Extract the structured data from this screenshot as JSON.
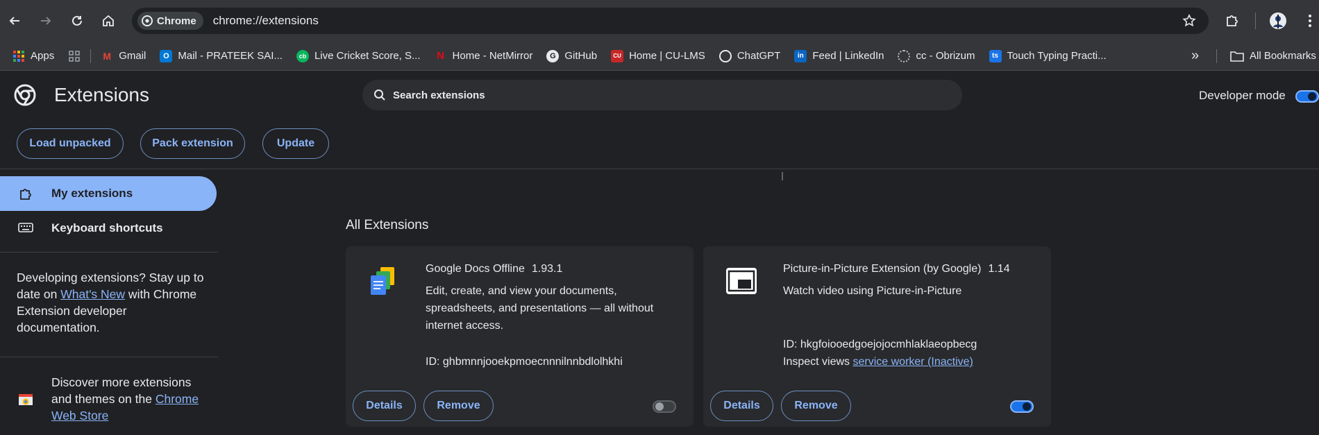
{
  "browser": {
    "chip_label": "Chrome",
    "url": "chrome://extensions"
  },
  "bookmarks": [
    {
      "label": "Apps",
      "icon": "apps-grid-icon",
      "color": "#ea4335"
    },
    {
      "label": "",
      "icon": "tab-groups-icon",
      "color": "#9aa0a6"
    },
    {
      "label": "Gmail",
      "icon": "gmail-icon",
      "color": "#ea4335"
    },
    {
      "label": "Mail - PRATEEK SAI...",
      "icon": "outlook-icon",
      "color": "#0078d4"
    },
    {
      "label": "Live Cricket Score, S...",
      "icon": "cricbuzz-icon",
      "color": "#09b65d"
    },
    {
      "label": "Home - NetMirror",
      "icon": "netmirror-icon",
      "color": "#e50914"
    },
    {
      "label": "GitHub",
      "icon": "github-icon",
      "color": "#ffffff"
    },
    {
      "label": "Home | CU-LMS",
      "icon": "cu-lms-icon",
      "color": "#c62828"
    },
    {
      "label": "ChatGPT",
      "icon": "chatgpt-icon",
      "color": "#ffffff"
    },
    {
      "label": "Feed | LinkedIn",
      "icon": "linkedin-icon",
      "color": "#0a66c2"
    },
    {
      "label": "cc - Obrizum",
      "icon": "obrizum-icon",
      "color": "#9aa0a6"
    },
    {
      "label": "Touch Typing Practi...",
      "icon": "typing-icon",
      "color": "#1a73e8"
    }
  ],
  "bookmarks_more": "»",
  "all_bookmarks_label": "All Bookmarks",
  "header": {
    "title": "Extensions",
    "search_placeholder": "Search extensions",
    "developer_mode_label": "Developer mode",
    "developer_mode": true
  },
  "actions": {
    "load_unpacked": "Load unpacked",
    "pack_extension": "Pack extension",
    "update": "Update"
  },
  "sidebar": {
    "my_extensions": "My extensions",
    "keyboard_shortcuts": "Keyboard shortcuts",
    "dev_text_before": "Developing extensions? Stay up to date on ",
    "whats_new_link": "What's New",
    "dev_text_after": " with Chrome Extension developer documentation.",
    "store_text": "Discover more extensions and themes on the ",
    "store_link": "Chrome Web Store"
  },
  "main": {
    "section_title": "All Extensions",
    "extensions": [
      {
        "name": "Google Docs Offline",
        "version": "1.93.1",
        "description": "Edit, create, and view your documents, spreadsheets, and presentations — all without internet access.",
        "id_text": "ID: ghbmnnjooekpmoecnnnilnnbdlolhkhi",
        "details_label": "Details",
        "remove_label": "Remove",
        "enabled": false
      },
      {
        "name": "Picture-in-Picture Extension (by Google)",
        "version": "1.14",
        "description": "Watch video using Picture-in-Picture",
        "id_text": "ID: hkgfoiooedgoejojocmhlaklaeopbecg",
        "inspect_label": "Inspect views",
        "inspect_link": "service worker (Inactive)",
        "details_label": "Details",
        "remove_label": "Remove",
        "enabled": true
      }
    ]
  }
}
